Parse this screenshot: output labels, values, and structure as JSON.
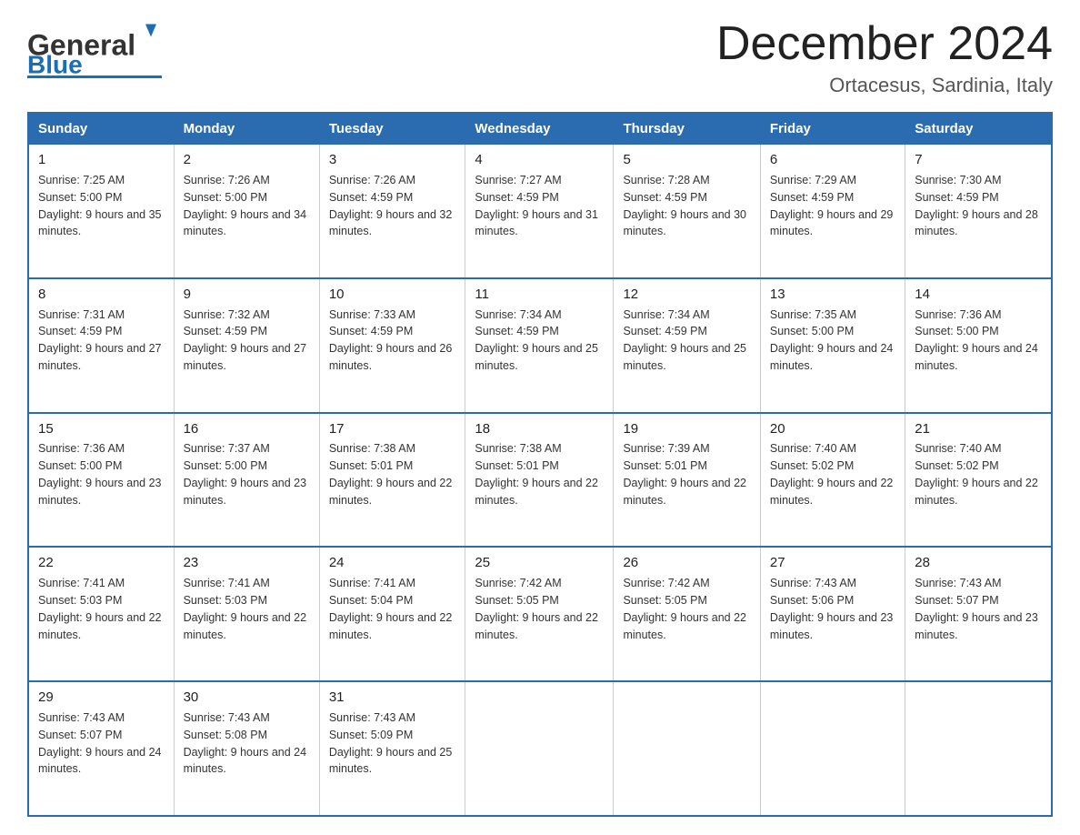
{
  "logo": {
    "line1": "General",
    "line2": "Blue",
    "alt": "GeneralBlue logo"
  },
  "header": {
    "title": "December 2024",
    "subtitle": "Ortacesus, Sardinia, Italy"
  },
  "weekdays": [
    "Sunday",
    "Monday",
    "Tuesday",
    "Wednesday",
    "Thursday",
    "Friday",
    "Saturday"
  ],
  "weeks": [
    [
      {
        "day": "1",
        "sunrise": "7:25 AM",
        "sunset": "5:00 PM",
        "daylight": "9 hours and 35 minutes."
      },
      {
        "day": "2",
        "sunrise": "7:26 AM",
        "sunset": "5:00 PM",
        "daylight": "9 hours and 34 minutes."
      },
      {
        "day": "3",
        "sunrise": "7:26 AM",
        "sunset": "4:59 PM",
        "daylight": "9 hours and 32 minutes."
      },
      {
        "day": "4",
        "sunrise": "7:27 AM",
        "sunset": "4:59 PM",
        "daylight": "9 hours and 31 minutes."
      },
      {
        "day": "5",
        "sunrise": "7:28 AM",
        "sunset": "4:59 PM",
        "daylight": "9 hours and 30 minutes."
      },
      {
        "day": "6",
        "sunrise": "7:29 AM",
        "sunset": "4:59 PM",
        "daylight": "9 hours and 29 minutes."
      },
      {
        "day": "7",
        "sunrise": "7:30 AM",
        "sunset": "4:59 PM",
        "daylight": "9 hours and 28 minutes."
      }
    ],
    [
      {
        "day": "8",
        "sunrise": "7:31 AM",
        "sunset": "4:59 PM",
        "daylight": "9 hours and 27 minutes."
      },
      {
        "day": "9",
        "sunrise": "7:32 AM",
        "sunset": "4:59 PM",
        "daylight": "9 hours and 27 minutes."
      },
      {
        "day": "10",
        "sunrise": "7:33 AM",
        "sunset": "4:59 PM",
        "daylight": "9 hours and 26 minutes."
      },
      {
        "day": "11",
        "sunrise": "7:34 AM",
        "sunset": "4:59 PM",
        "daylight": "9 hours and 25 minutes."
      },
      {
        "day": "12",
        "sunrise": "7:34 AM",
        "sunset": "4:59 PM",
        "daylight": "9 hours and 25 minutes."
      },
      {
        "day": "13",
        "sunrise": "7:35 AM",
        "sunset": "5:00 PM",
        "daylight": "9 hours and 24 minutes."
      },
      {
        "day": "14",
        "sunrise": "7:36 AM",
        "sunset": "5:00 PM",
        "daylight": "9 hours and 24 minutes."
      }
    ],
    [
      {
        "day": "15",
        "sunrise": "7:36 AM",
        "sunset": "5:00 PM",
        "daylight": "9 hours and 23 minutes."
      },
      {
        "day": "16",
        "sunrise": "7:37 AM",
        "sunset": "5:00 PM",
        "daylight": "9 hours and 23 minutes."
      },
      {
        "day": "17",
        "sunrise": "7:38 AM",
        "sunset": "5:01 PM",
        "daylight": "9 hours and 22 minutes."
      },
      {
        "day": "18",
        "sunrise": "7:38 AM",
        "sunset": "5:01 PM",
        "daylight": "9 hours and 22 minutes."
      },
      {
        "day": "19",
        "sunrise": "7:39 AM",
        "sunset": "5:01 PM",
        "daylight": "9 hours and 22 minutes."
      },
      {
        "day": "20",
        "sunrise": "7:40 AM",
        "sunset": "5:02 PM",
        "daylight": "9 hours and 22 minutes."
      },
      {
        "day": "21",
        "sunrise": "7:40 AM",
        "sunset": "5:02 PM",
        "daylight": "9 hours and 22 minutes."
      }
    ],
    [
      {
        "day": "22",
        "sunrise": "7:41 AM",
        "sunset": "5:03 PM",
        "daylight": "9 hours and 22 minutes."
      },
      {
        "day": "23",
        "sunrise": "7:41 AM",
        "sunset": "5:03 PM",
        "daylight": "9 hours and 22 minutes."
      },
      {
        "day": "24",
        "sunrise": "7:41 AM",
        "sunset": "5:04 PM",
        "daylight": "9 hours and 22 minutes."
      },
      {
        "day": "25",
        "sunrise": "7:42 AM",
        "sunset": "5:05 PM",
        "daylight": "9 hours and 22 minutes."
      },
      {
        "day": "26",
        "sunrise": "7:42 AM",
        "sunset": "5:05 PM",
        "daylight": "9 hours and 22 minutes."
      },
      {
        "day": "27",
        "sunrise": "7:43 AM",
        "sunset": "5:06 PM",
        "daylight": "9 hours and 23 minutes."
      },
      {
        "day": "28",
        "sunrise": "7:43 AM",
        "sunset": "5:07 PM",
        "daylight": "9 hours and 23 minutes."
      }
    ],
    [
      {
        "day": "29",
        "sunrise": "7:43 AM",
        "sunset": "5:07 PM",
        "daylight": "9 hours and 24 minutes."
      },
      {
        "day": "30",
        "sunrise": "7:43 AM",
        "sunset": "5:08 PM",
        "daylight": "9 hours and 24 minutes."
      },
      {
        "day": "31",
        "sunrise": "7:43 AM",
        "sunset": "5:09 PM",
        "daylight": "9 hours and 25 minutes."
      },
      null,
      null,
      null,
      null
    ]
  ]
}
